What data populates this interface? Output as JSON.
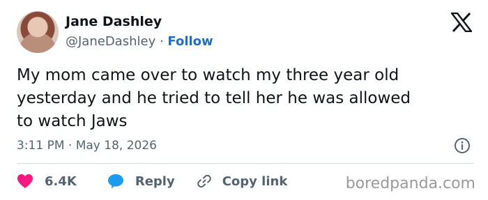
{
  "author": {
    "name": "Jane Dashley",
    "handle": "@JaneDashley",
    "separator": " · ",
    "follow_label": "Follow"
  },
  "tweet": {
    "text": "My mom came over to watch my three year old\nyesterday and he tried to tell her he was allowed\nto watch Jaws",
    "timestamp": "3:11 PM · May 18, 2026"
  },
  "actions": {
    "likes": "6.4K",
    "reply_label": "Reply",
    "copy_link_label": "Copy link"
  },
  "watermark": "boredpanda.com",
  "colors": {
    "like": "#f91880",
    "reply": "#1d9bf0",
    "follow": "#1d6fc9",
    "secondary_text": "#536471"
  },
  "icons": {
    "platform": "x-logo-icon",
    "info": "info-icon",
    "like": "heart-icon",
    "reply": "speech-bubble-icon",
    "copy_link": "link-icon"
  }
}
